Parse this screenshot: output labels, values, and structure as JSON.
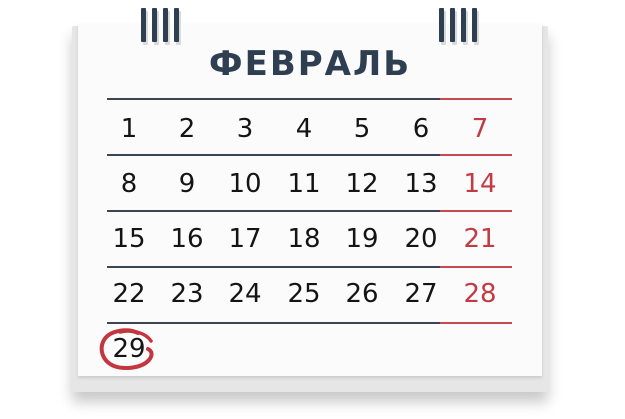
{
  "calendar": {
    "month": "ФЕВРАЛЬ",
    "weeks": [
      [
        "1",
        "2",
        "3",
        "4",
        "5",
        "6",
        "7"
      ],
      [
        "8",
        "9",
        "10",
        "11",
        "12",
        "13",
        "14"
      ],
      [
        "15",
        "16",
        "17",
        "18",
        "19",
        "20",
        "21"
      ],
      [
        "22",
        "23",
        "24",
        "25",
        "26",
        "27",
        "28"
      ],
      [
        "29"
      ]
    ],
    "highlighted_day": "29",
    "colors": {
      "title": "#2f3f52",
      "weekend": "#c23a44",
      "circle": "#c4363f"
    }
  }
}
